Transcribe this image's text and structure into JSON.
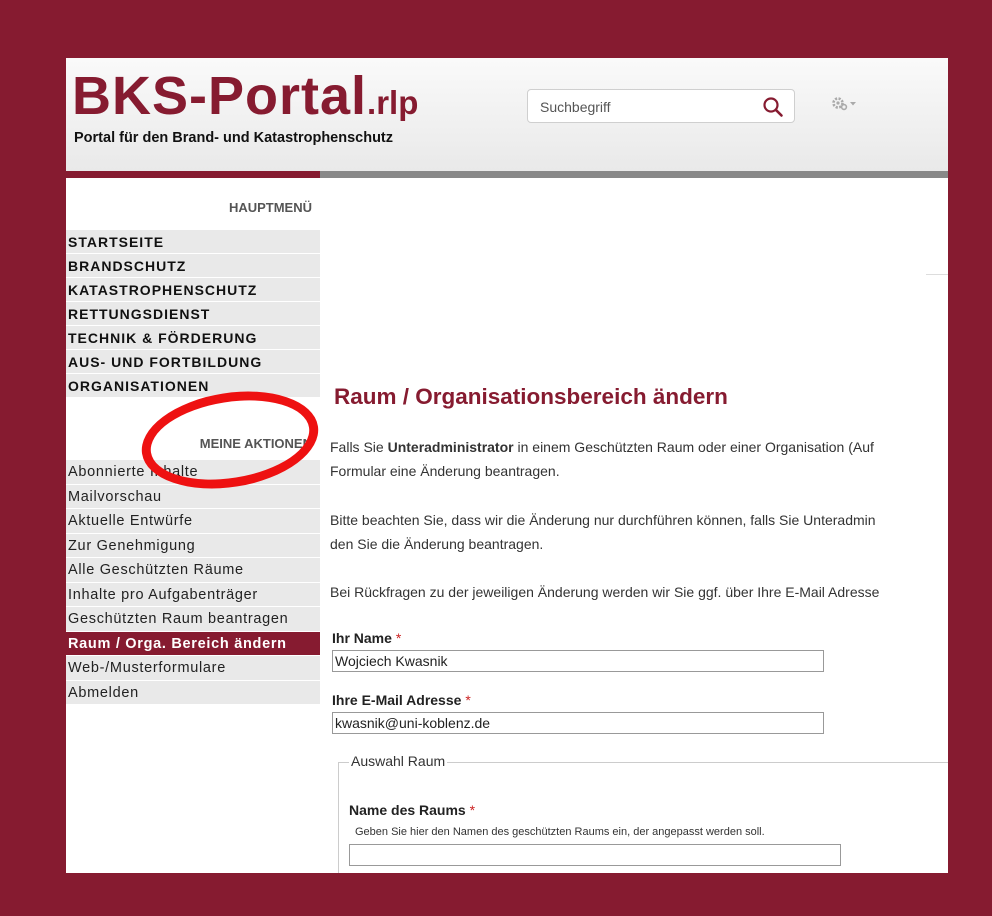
{
  "header": {
    "logo_main": "BKS-Portal",
    "logo_suffix": ".rlp",
    "tagline": "Portal für den Brand- und Katastrophenschutz",
    "search_placeholder": "Suchbegriff"
  },
  "sidebar": {
    "main_heading": "HAUPTMENÜ",
    "main_items": [
      {
        "label": "STARTSEITE"
      },
      {
        "label": "BRANDSCHUTZ"
      },
      {
        "label": "KATASTROPHENSCHUTZ"
      },
      {
        "label": "RETTUNGSDIENST"
      },
      {
        "label": "TECHNIK & FÖRDERUNG"
      },
      {
        "label": "AUS- UND FORTBILDUNG"
      },
      {
        "label": "ORGANISATIONEN"
      }
    ],
    "actions_heading": "MEINE AKTIONEN",
    "action_items": [
      {
        "label": "Abonnierte Inhalte"
      },
      {
        "label": "Mailvorschau"
      },
      {
        "label": "Aktuelle Entwürfe"
      },
      {
        "label": "Zur Genehmigung"
      },
      {
        "label": "Alle Geschützten Räume"
      },
      {
        "label": "Inhalte pro Aufgabenträger"
      },
      {
        "label": "Geschützten Raum beantragen"
      },
      {
        "label": "Raum / Orga. Bereich ändern",
        "active": true
      },
      {
        "label": "Web-/Musterformulare"
      },
      {
        "label": "Abmelden"
      }
    ]
  },
  "main": {
    "title": "Raum / Organisationsbereich ändern",
    "intro_line1_pre": "Falls Sie ",
    "intro_line1_bold": "Unteradministrator",
    "intro_line1_post": " in einem Geschützten Raum oder einer Organisation (Auf",
    "intro_line2": "Formular eine Änderung beantragen.",
    "note_line1": "Bitte beachten Sie, dass wir die Änderung nur durchführen können, falls Sie Unteradmin",
    "note_line2": "den Sie die Änderung beantragen.",
    "contact_line": "Bei Rückfragen zu der jeweiligen Änderung werden wir Sie ggf. über Ihre E-Mail Adresse",
    "name_label": "Ihr Name",
    "name_value": "Wojciech Kwasnik",
    "email_label": "Ihre E-Mail Adresse",
    "email_value": "kwasnik@uni-koblenz.de",
    "required_marker": "*",
    "fieldset_legend": "Auswahl Raum",
    "room_label": "Name des Raums",
    "room_hint": "Geben Sie hier den Namen des geschützten Raums ein, der angepasst werden soll.",
    "room_value": ""
  },
  "colors": {
    "brand": "#861b30",
    "highlight_circle": "#ee1111"
  }
}
